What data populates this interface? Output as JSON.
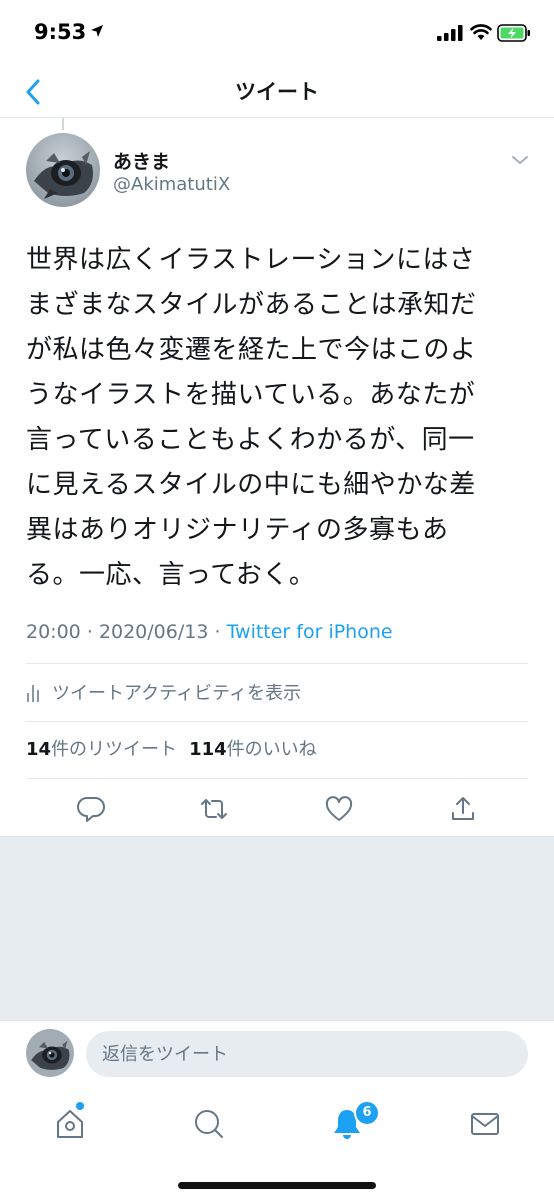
{
  "status_bar": {
    "time": "9:53",
    "icons": [
      "location-arrow-icon",
      "signal-icon",
      "wifi-icon",
      "battery-charging-icon"
    ]
  },
  "header": {
    "back_icon": "chevron-left-icon",
    "title": "ツイート"
  },
  "tweet": {
    "author_name": "あきま",
    "author_handle": "@AkimatutiX",
    "text_lines": [
      "世界は広くイラストレーションにはさ",
      "まざまなスタイルがあることは承知だ",
      "が私は色々変遷を経た上で今はこのよ",
      "うなイラストを描いている。あなたが",
      "言っていることもよくわかるが、同一",
      "に見えるスタイルの中にも細やかな差",
      "異はありオリジナリティの多寡もあ",
      "る。一応、言っておく。"
    ],
    "time": "20:00",
    "date": "2020/06/13",
    "separator": "·",
    "source": "Twitter for iPhone",
    "activity_label": "ツイートアクティビティを表示",
    "retweet_count": "14",
    "retweet_label": "件のリツイート",
    "like_count": "114",
    "like_label": "件のいいね"
  },
  "actions": [
    "reply-icon",
    "retweet-icon",
    "like-icon",
    "share-icon"
  ],
  "reply": {
    "placeholder": "返信をツイート"
  },
  "tab_bar": {
    "tabs": [
      "home-icon",
      "search-icon",
      "notifications-icon",
      "messages-icon"
    ],
    "notification_count": "6"
  },
  "colors": {
    "accent": "#1da1f2",
    "secondary_text": "#657786",
    "primary_text": "#14171a",
    "background_gray": "#e6ecf0"
  }
}
